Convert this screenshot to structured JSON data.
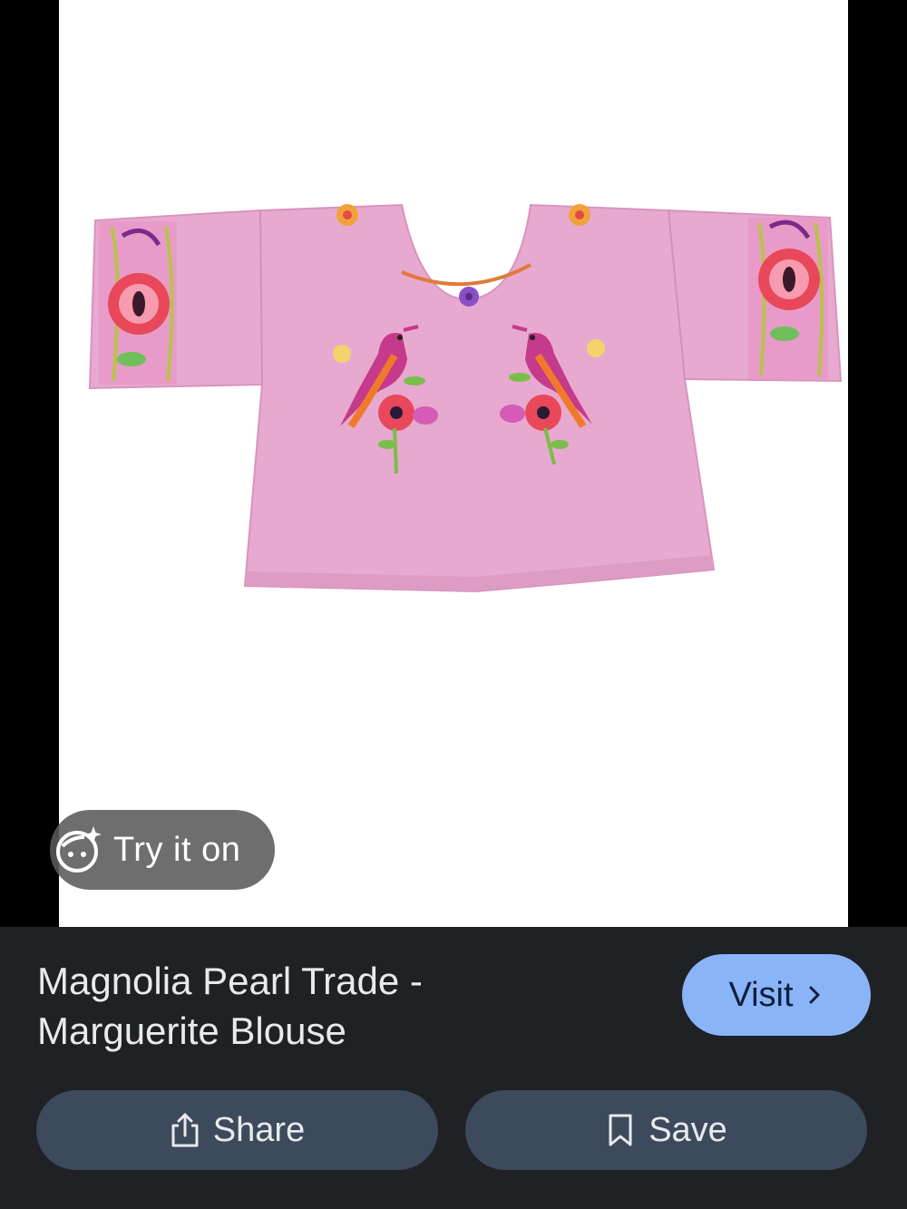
{
  "viewer": {
    "image_subject": "pink embroidered blouse",
    "try_on_label": "Try it on",
    "try_on_icon": "sparkle-face-icon"
  },
  "details": {
    "title": "Magnolia Pearl Trade -\nMarguerite Blouse",
    "visit_label": "Visit",
    "visit_icon": "chevron-right-icon",
    "share_label": "Share",
    "share_icon": "share-icon",
    "save_label": "Save",
    "save_icon": "bookmark-icon"
  },
  "colors": {
    "panel_bg": "#202125",
    "visit_bg": "#8ab4f8",
    "action_bg": "#3c4a5c",
    "blouse": "#e7a9cf"
  }
}
